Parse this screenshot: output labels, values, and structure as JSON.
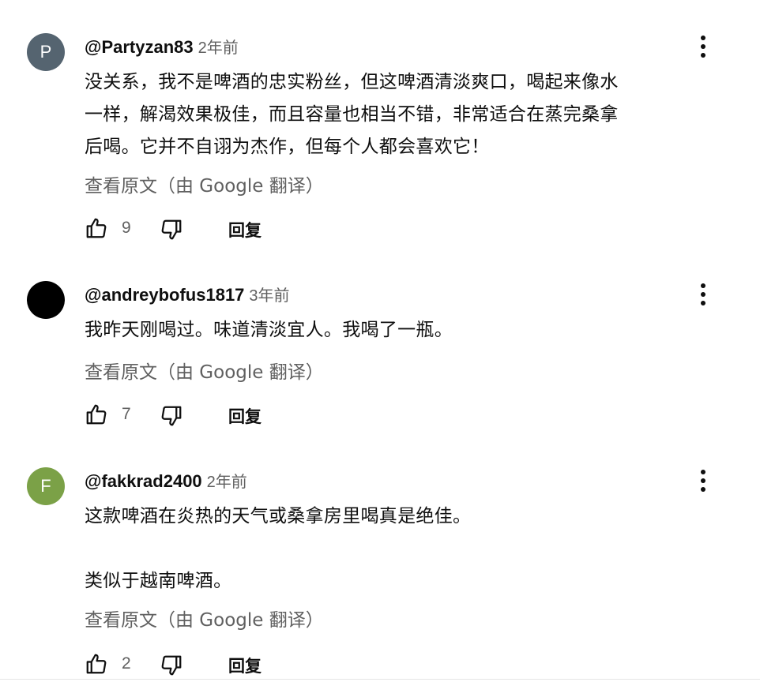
{
  "comments": [
    {
      "avatar_letter": "P",
      "avatar_color": "#556470",
      "author": "@Partyzan83",
      "time": "2年前",
      "lines": [
        "没关系，我不是啤酒的忠实粉丝，但这啤酒清淡爽口，喝起来像水",
        "一样，解渴效果极佳，而且容量也相当不错，非常适合在蒸完桑拿",
        "后喝。它并不自诩为杰作，但每个人都会喜欢它！"
      ],
      "translate_label": "查看原文（由 Google 翻译）",
      "likes": "9",
      "reply_label": "回复"
    },
    {
      "avatar_letter": "",
      "avatar_color": "#000000",
      "author": "@andreybofus1817",
      "time": "3年前",
      "lines": [
        "我昨天刚喝过。味道清淡宜人。我喝了一瓶。"
      ],
      "translate_label": "查看原文（由 Google 翻译）",
      "likes": "7",
      "reply_label": "回复"
    },
    {
      "avatar_letter": "F",
      "avatar_color": "#7ba147",
      "author": "@fakkrad2400",
      "time": "2年前",
      "lines": [
        "这款啤酒在炎热的天气或桑拿房里喝真是绝佳。",
        "",
        "类似于越南啤酒。"
      ],
      "translate_label": "查看原文（由 Google 翻译）",
      "likes": "2",
      "reply_label": "回复"
    }
  ],
  "icons": {
    "like": "thumbs-up-icon",
    "dislike": "thumbs-down-icon",
    "menu": "more-vert-icon"
  }
}
